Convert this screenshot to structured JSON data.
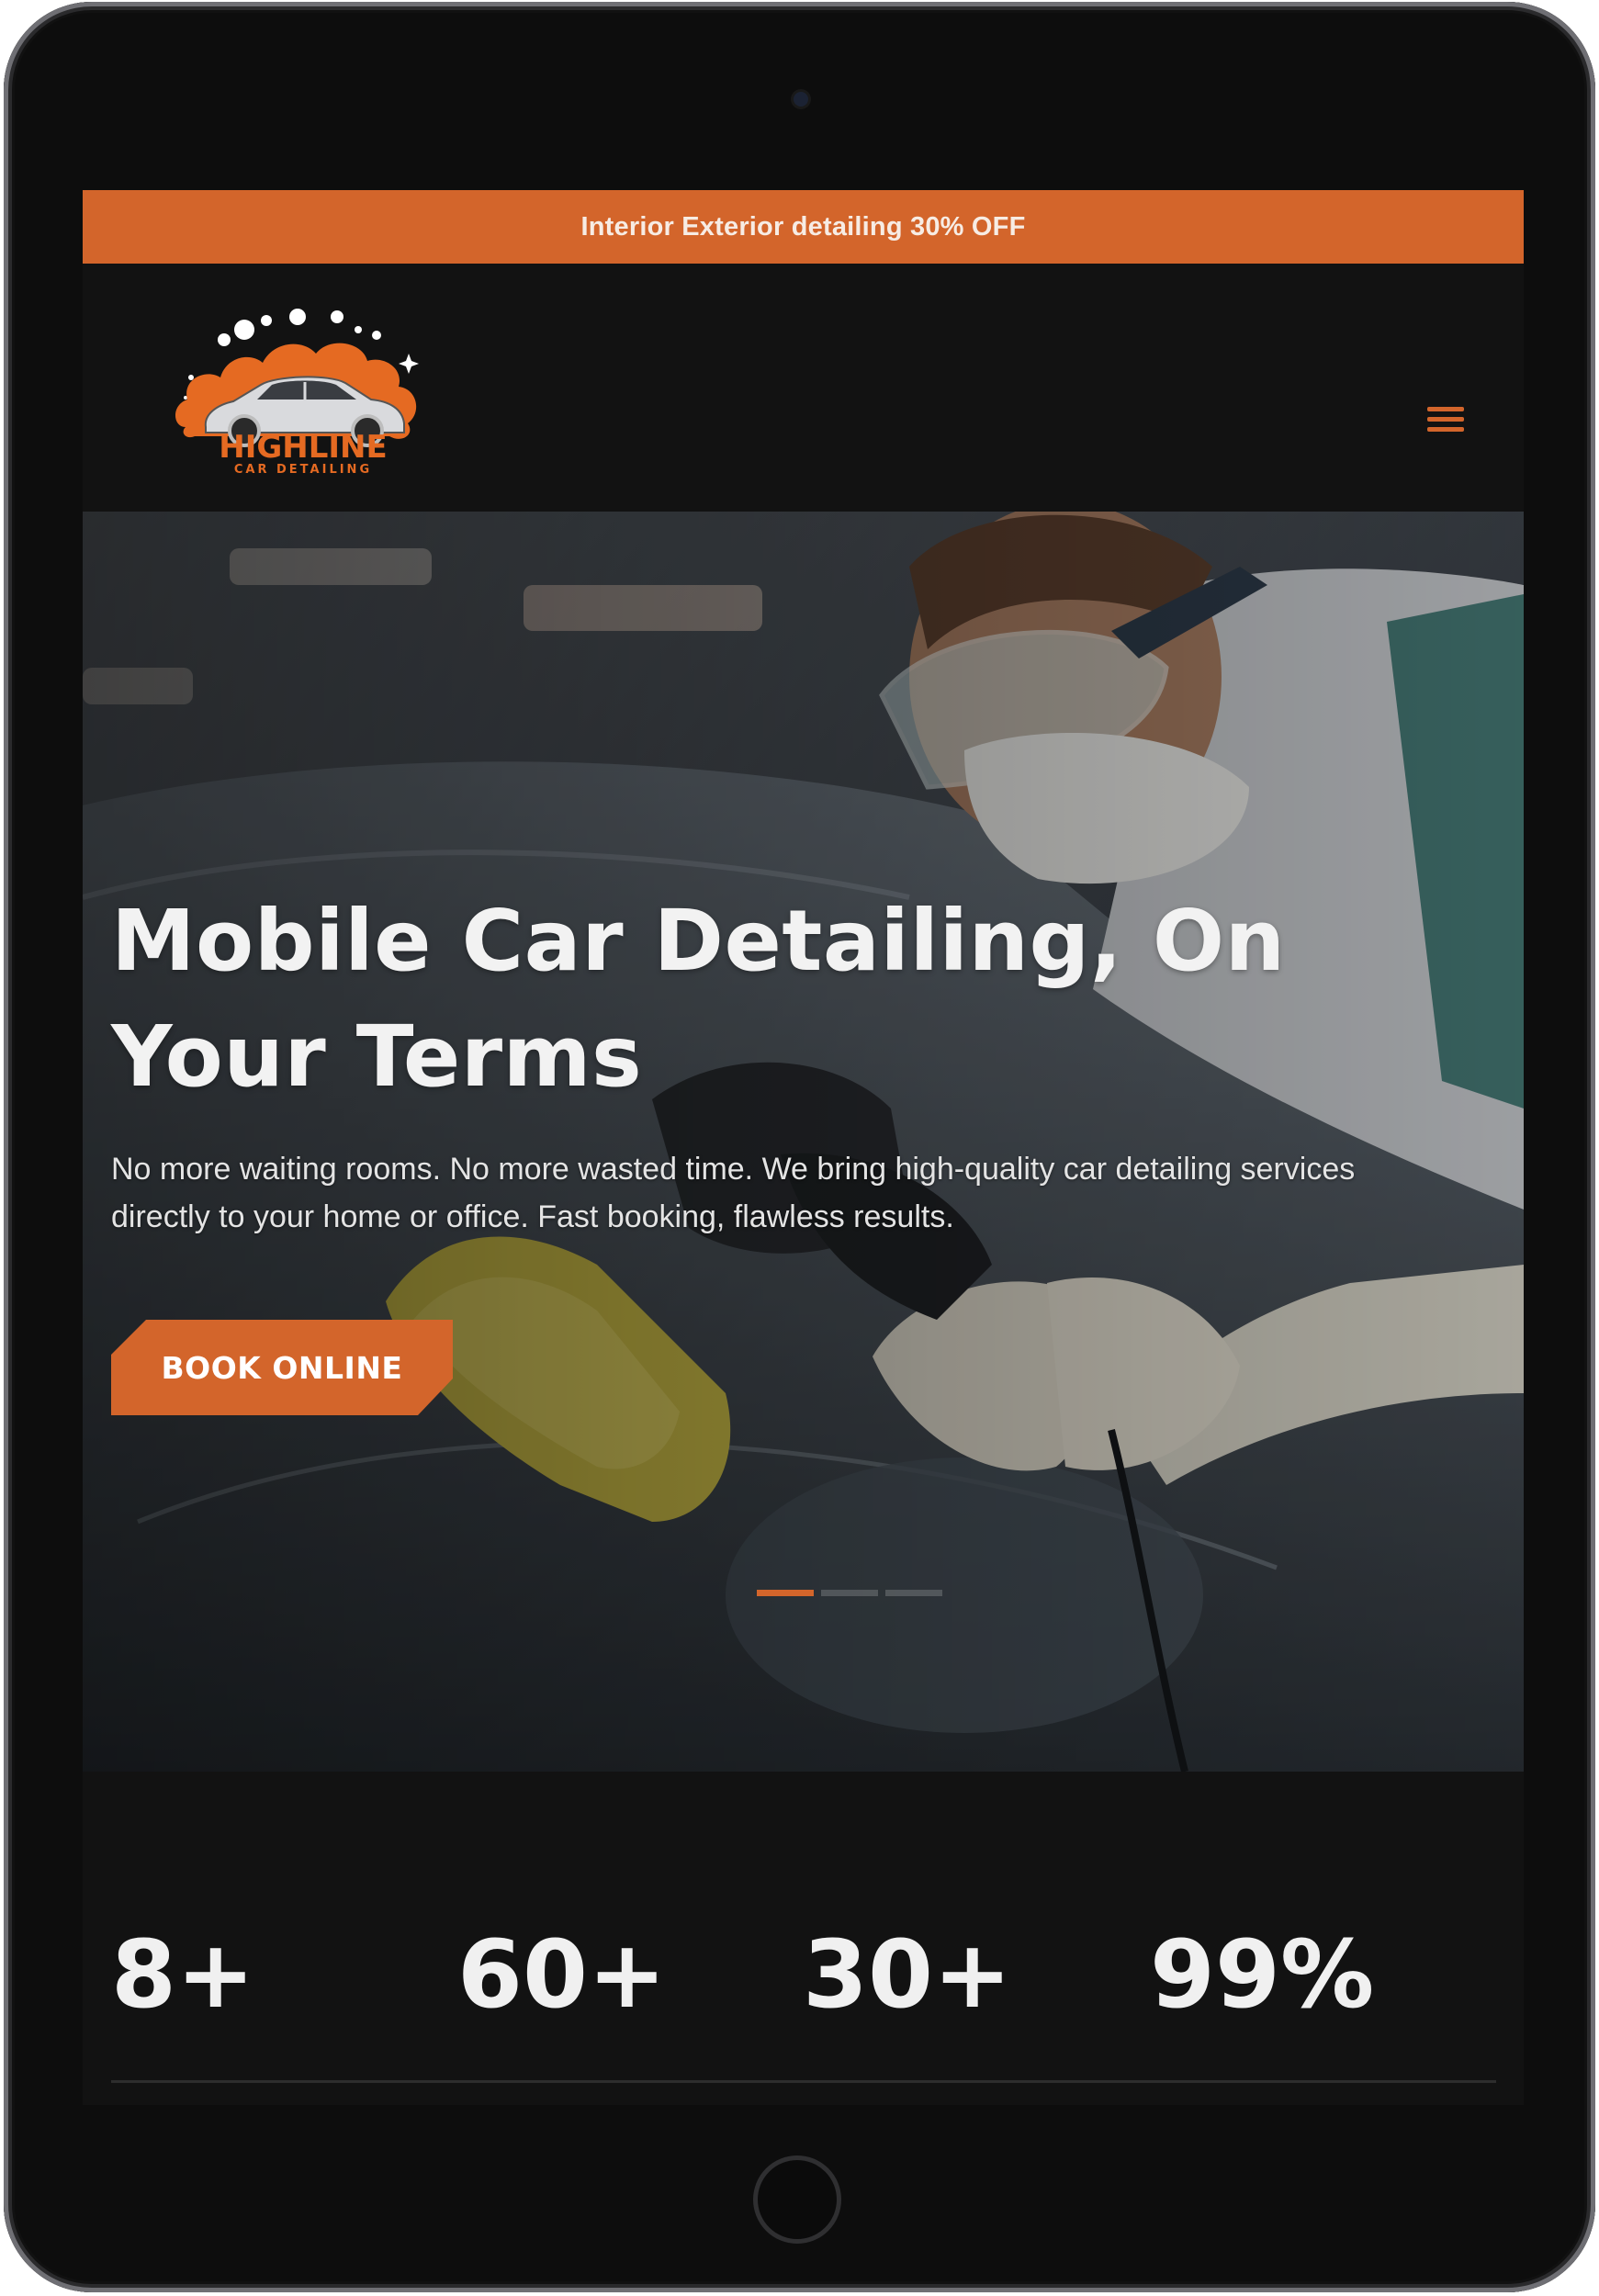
{
  "promo_bar": {
    "text": "Interior Exterior detailing 30% OFF"
  },
  "header": {
    "logo": {
      "brand": "HIGHLINE",
      "tagline": "CAR DETAILING"
    },
    "menu_icon": "hamburger-menu-icon"
  },
  "hero": {
    "title": "Mobile Car Detailing, On Your Terms",
    "description": "No more waiting rooms. No more wasted time. We bring high-quality car detailing services directly to your home or office. Fast booking, flawless results.",
    "cta_label": "BOOK ONLINE",
    "slides_total": 3,
    "active_slide": 1
  },
  "stats": [
    {
      "value": "8+"
    },
    {
      "value": "60+"
    },
    {
      "value": "30+"
    },
    {
      "value": "99%"
    }
  ],
  "colors": {
    "accent": "#d3652b",
    "background": "#121212",
    "text_light": "#f0f0f0"
  }
}
